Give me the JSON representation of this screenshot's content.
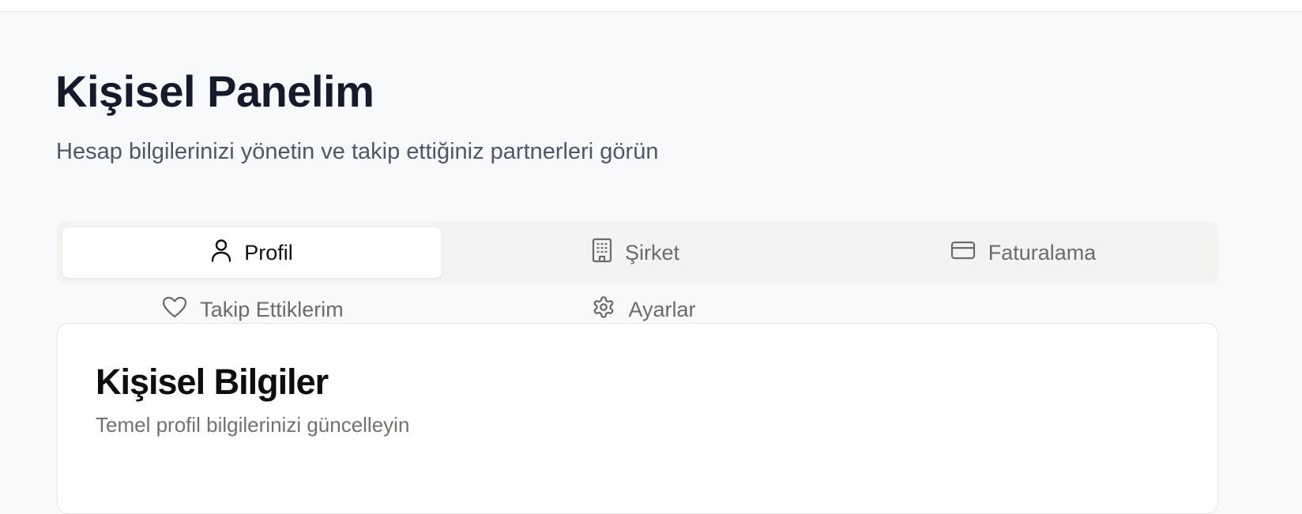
{
  "header": {
    "title": "Kişisel Panelim",
    "subtitle": "Hesap bilgilerinizi yönetin ve takip ettiğiniz partnerleri görün"
  },
  "tabs": [
    {
      "label": "Profil",
      "icon": "user-icon",
      "active": true
    },
    {
      "label": "Şirket",
      "icon": "building-icon",
      "active": false
    },
    {
      "label": "Faturalama",
      "icon": "credit-card-icon",
      "active": false
    },
    {
      "label": "Takip Ettiklerim",
      "icon": "heart-icon",
      "active": false
    },
    {
      "label": "Ayarlar",
      "icon": "gear-icon",
      "active": false
    }
  ],
  "card": {
    "title": "Kişisel Bilgiler",
    "subtitle": "Temel profil bilgilerinizi güncelleyin"
  }
}
